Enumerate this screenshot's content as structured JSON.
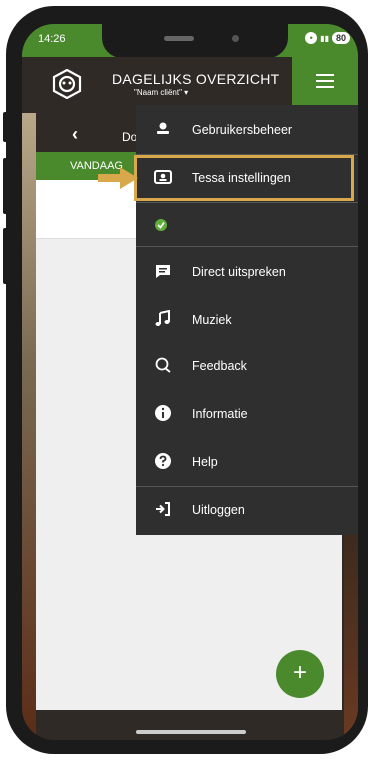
{
  "status": {
    "time": "14:26",
    "battery": "80"
  },
  "header": {
    "title": "DAGELIJKS OVERZICHT",
    "subtitle": "\"Naam cliënt\" ▾"
  },
  "card": {
    "title_fragment": "Do",
    "tab_label": "VANDAAG"
  },
  "menu": {
    "items": [
      {
        "label": "Gebruikersbeheer",
        "icon": "user-icon"
      },
      {
        "label": "Tessa instellingen",
        "icon": "tablet-settings-icon"
      },
      {
        "label": "",
        "icon": "check-circle-icon"
      },
      {
        "label": "Direct uitspreken",
        "icon": "message-icon"
      },
      {
        "label": "Muziek",
        "icon": "music-icon"
      },
      {
        "label": "Feedback",
        "icon": "feedback-icon"
      },
      {
        "label": "Informatie",
        "icon": "info-icon"
      },
      {
        "label": "Help",
        "icon": "help-icon"
      },
      {
        "label": "Uitloggen",
        "icon": "logout-icon"
      }
    ]
  },
  "fab": {
    "label": "+"
  },
  "colors": {
    "brand_green": "#4a8a2c",
    "dark_bg": "#2f2a26",
    "menu_bg": "#2f2f2f",
    "highlight": "#d8a84a"
  }
}
